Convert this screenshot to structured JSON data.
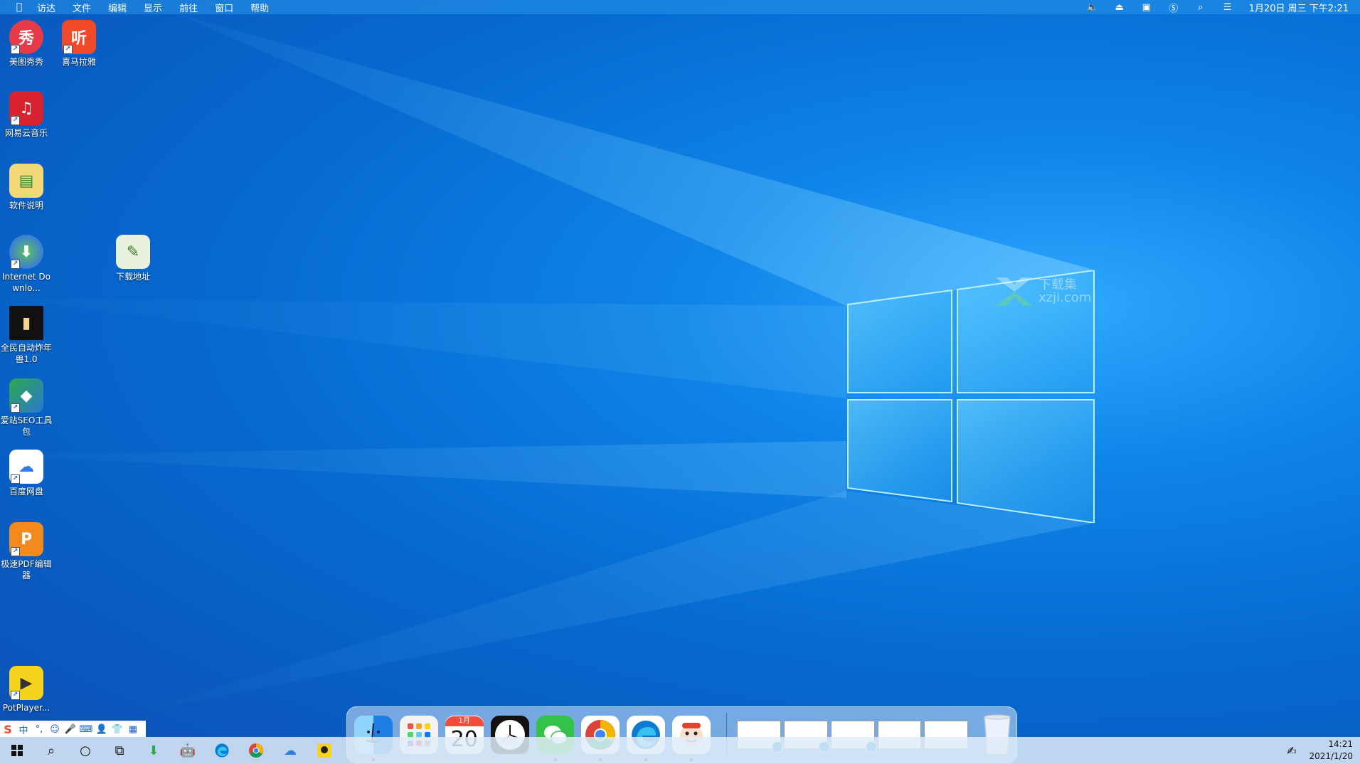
{
  "menubar": {
    "apple_icon": "apple-icon",
    "items": [
      "访达",
      "文件",
      "编辑",
      "显示",
      "前往",
      "窗口",
      "帮助"
    ],
    "datetime": "1月20日 周三 下午2:21",
    "icons": [
      "volume-icon",
      "eject-icon",
      "input-method-icon",
      "sogou-icon",
      "search-icon",
      "control-center-icon"
    ]
  },
  "desktop": {
    "icons": [
      {
        "label": "美图秀秀",
        "glyph": "秀",
        "color": "#e83b4a",
        "shortcut": true
      },
      {
        "label": "喜马拉雅",
        "glyph": "听",
        "color": "#f04a2a",
        "shortcut": true
      },
      {
        "label": "网易云音乐",
        "glyph": "♫",
        "color": "#d8222f",
        "shortcut": true
      },
      {
        "label": "软件说明",
        "glyph": "▤",
        "color": "#f3d878",
        "shortcut": false
      },
      {
        "label": "Internet Downlo...",
        "glyph": "⬇",
        "color": "#3a7dd8",
        "shortcut": true
      },
      {
        "label": "下载地址",
        "glyph": "✎",
        "color": "#e9f2df",
        "shortcut": false
      },
      {
        "label": "全民自动炸年兽1.0",
        "glyph": "▮",
        "color": "#f5d58a",
        "shortcut": false
      },
      {
        "label": "爱站SEO工具包",
        "glyph": "◆",
        "color": "#2ea84e",
        "shortcut": true
      },
      {
        "label": "百度网盘",
        "glyph": "☁",
        "color": "#ffffff",
        "shortcut": true
      },
      {
        "label": "极速PDF编辑器",
        "glyph": "P",
        "color": "#f48a1e",
        "shortcut": true
      },
      {
        "label": "PotPlayer...",
        "glyph": "▶",
        "color": "#f6d31c",
        "shortcut": true
      }
    ]
  },
  "watermark": {
    "line1": "下载集",
    "line2": "xzji.com"
  },
  "dock": {
    "apps": [
      {
        "name": "finder",
        "icon": "finder-icon",
        "running": true
      },
      {
        "name": "launchpad",
        "icon": "launchpad-icon",
        "running": false
      },
      {
        "name": "calendar",
        "icon": "calendar-icon",
        "running": false,
        "month": "1月",
        "day": "20"
      },
      {
        "name": "clock",
        "icon": "clock-icon",
        "running": false
      },
      {
        "name": "wechat",
        "icon": "wechat-icon",
        "running": true
      },
      {
        "name": "chrome",
        "icon": "chrome-icon",
        "running": true
      },
      {
        "name": "edge",
        "icon": "edge-icon",
        "running": true
      },
      {
        "name": "mascot",
        "icon": "mascot-icon",
        "running": true
      }
    ],
    "thumbnails": 5,
    "trash_icon": "trash-icon"
  },
  "ime": {
    "logo": "S",
    "buttons": [
      "中",
      "°,",
      "☺",
      "🎤",
      "⌨",
      "👤",
      "👕",
      "▦"
    ]
  },
  "taskbar": {
    "start_icon": "windows-start-icon",
    "items": [
      "search-icon",
      "cortana-icon",
      "task-view-icon",
      "download-icon",
      "android-icon",
      "edge-icon",
      "chrome-icon",
      "baidu-netdisk-icon",
      "yellow-app-icon"
    ],
    "tray_icon": "pen-icon",
    "time": "14:21",
    "date": "2021/1/20"
  }
}
